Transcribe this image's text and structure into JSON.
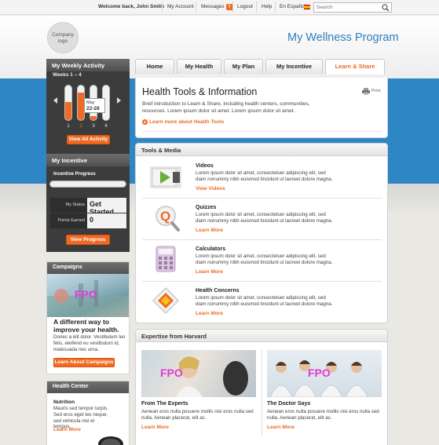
{
  "topbar": {
    "welcome": "Welcome back, John Smith",
    "my_account": "My Account",
    "messages": "Messages",
    "messages_count": "7",
    "logout": "Logout",
    "help": "Help",
    "language": "En Español",
    "search_placeholder": "Search"
  },
  "header": {
    "logo": "Company logo",
    "title": "My Wellness Program"
  },
  "nav": {
    "tabs": [
      "Home",
      "My Health",
      "My Plan",
      "My Incentive",
      "Learn & Share"
    ],
    "active": "Learn & Share"
  },
  "activity": {
    "title": "My Weekly Activity",
    "range": "Weeks 1 – 4",
    "weeks": [
      "1",
      "2",
      "3",
      "4"
    ],
    "tooltip_month": "May",
    "tooltip_days": "22-28",
    "button": "View All Activity",
    "progress": [
      0.5,
      0.75,
      0.1,
      0.0
    ],
    "accent": "#ef6a22"
  },
  "incentive": {
    "title": "My Incentive",
    "progress_label": "Incentive Progress",
    "status_label": "My Status",
    "status_value": "Get Started",
    "points_label": "Points Earned",
    "points_value": "0",
    "button": "View Progress"
  },
  "campaigns": {
    "title": "Campaigns",
    "fpo": "FPO",
    "headline": "A different way to improve your health.",
    "body": "Donec a elit dolor. Vestibulum leo felis, eleifend eu vestibulum id, malesuada nec urna.",
    "button": "Learn About Campaigns"
  },
  "health_center": {
    "title": "Health Center",
    "item_title": "Nutrition",
    "body": "Mauris sed tempor turpis. Sed eros eget leo neque, sed vehicula nisi et tempus.",
    "link": "Learn More"
  },
  "main": {
    "title": "Health Tools & Information",
    "print": "Print",
    "intro": "Brief introduction to Learn & Share, including health centers, communities, resources. Lorem ipsum dolor sit amet. Lorem ipsum dolor sit amet.",
    "learn_more": "Learn more about Health Tools"
  },
  "tools": {
    "title": "Tools & Media",
    "items": [
      {
        "title": "Videos",
        "desc": "Lorem ipsum dolor sit amet, consectetuer adipiscing elit, sed diam nonummy nibh euismod tincidunt ut laoreet dolore magna.",
        "link": "View Videos",
        "icon": "video-play-icon"
      },
      {
        "title": "Quizzes",
        "desc": "Lorem ipsum dolor sit amet, consectetuer adipiscing elit, sed diam nonummy nibh euismod tincidunt ut laoreet dolore magna.",
        "link": "Learn More",
        "icon": "quiz-magnifier-icon"
      },
      {
        "title": "Calculators",
        "desc": "Lorem ipsum dolor sit amet, consectetuer adipiscing elit, sed diam nonummy nibh euismod tincidunt ut laoreet dolore magna.",
        "link": "Learn More",
        "icon": "calculator-icon"
      },
      {
        "title": "Health Concerns",
        "desc": "Lorem ipsum dolor sit amet, consectetuer adipiscing elit, sed diam nonummy nibh euismod tincidunt ut laoreet dolore magna.",
        "link": "Learn More",
        "icon": "health-concerns-icon"
      }
    ]
  },
  "harvard": {
    "title": "Expertise from Harvard",
    "cards": [
      {
        "fpo": "FPO",
        "title": "From The Experts",
        "desc": "Aenean eros nulla posuere mollis nisi eros nulla sed nulla. Aenean placerat, elit ac.",
        "link": "Learn More"
      },
      {
        "fpo": "FPO",
        "title": "The Doctor Says",
        "desc": "Aenean eros nulla posuere mollis nisi eros nulla sed nulla. Aenean placerat, elit ac.",
        "link": "Learn More"
      }
    ]
  }
}
